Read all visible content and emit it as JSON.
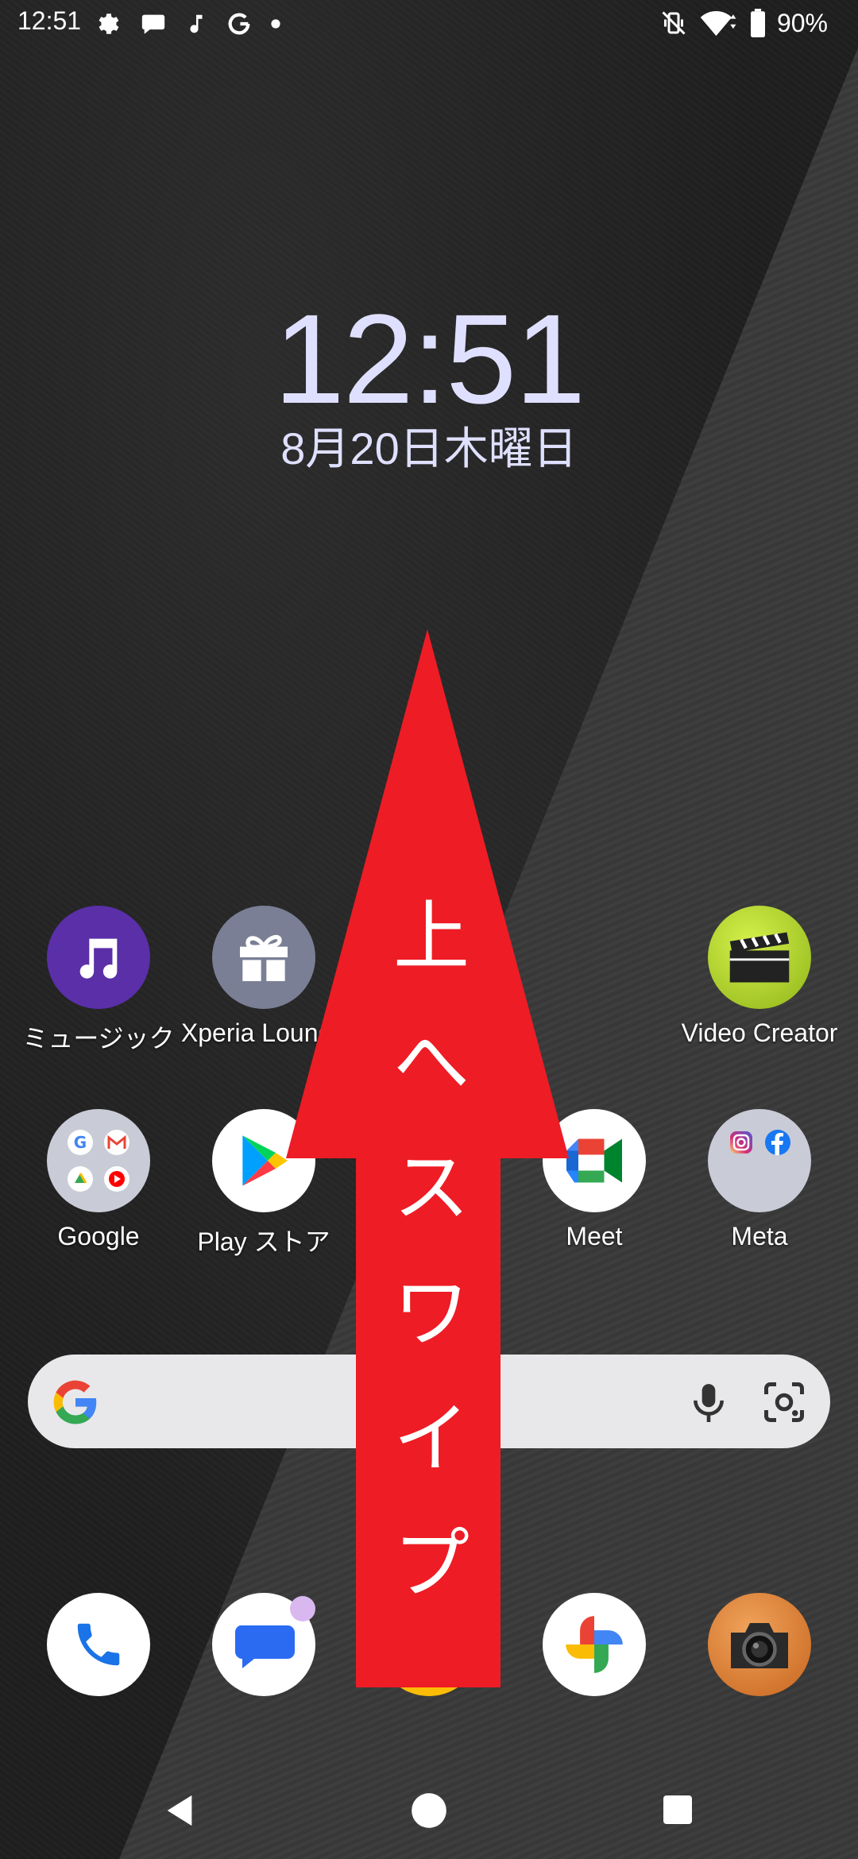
{
  "status_bar": {
    "time": "12:51",
    "battery": "90%",
    "left_icons": [
      "gear-icon",
      "chat-bubble-icon",
      "music-note-icon",
      "google-g-icon",
      "dot-icon"
    ],
    "right_icons": [
      "vibrate-mute-icon",
      "wifi-icon",
      "battery-icon"
    ]
  },
  "lockscreen_clock": {
    "time": "12:51",
    "date": "8月20日木曜日"
  },
  "home_row1": [
    {
      "label": "ミュージック",
      "icon": "music-note-icon",
      "color": "#5a2fa8"
    },
    {
      "label": "Xperia Lounge",
      "icon": "gift-icon",
      "color": "#7a7f95"
    },
    {
      "label": "Video Creator",
      "icon": "clapperboard-icon",
      "color": "#b6dc2a"
    }
  ],
  "home_row2": [
    {
      "label": "Google",
      "icon": "folder-icon"
    },
    {
      "label": "Play ストア",
      "icon": "play-store-icon"
    },
    {
      "label": "Meet",
      "icon": "meet-icon"
    },
    {
      "label": "Meta",
      "icon": "folder-icon"
    }
  ],
  "search_bar": {
    "icons": [
      "google-g-icon",
      "microphone-icon",
      "lens-icon"
    ]
  },
  "dock": {
    "icons": [
      "phone-icon",
      "messages-icon",
      "chrome-icon",
      "photos-icon",
      "camera-icon"
    ]
  },
  "nav_bar": {
    "icons": [
      "back-icon",
      "home-icon",
      "recents-icon"
    ]
  },
  "overlay": {
    "text": [
      "上",
      "へ",
      "ス",
      "ワ",
      "イ",
      "プ"
    ],
    "color": "#ee1c25"
  },
  "colors": {
    "clock": "#dfe0ff",
    "search_bar_bg": "#e8e8ea"
  }
}
